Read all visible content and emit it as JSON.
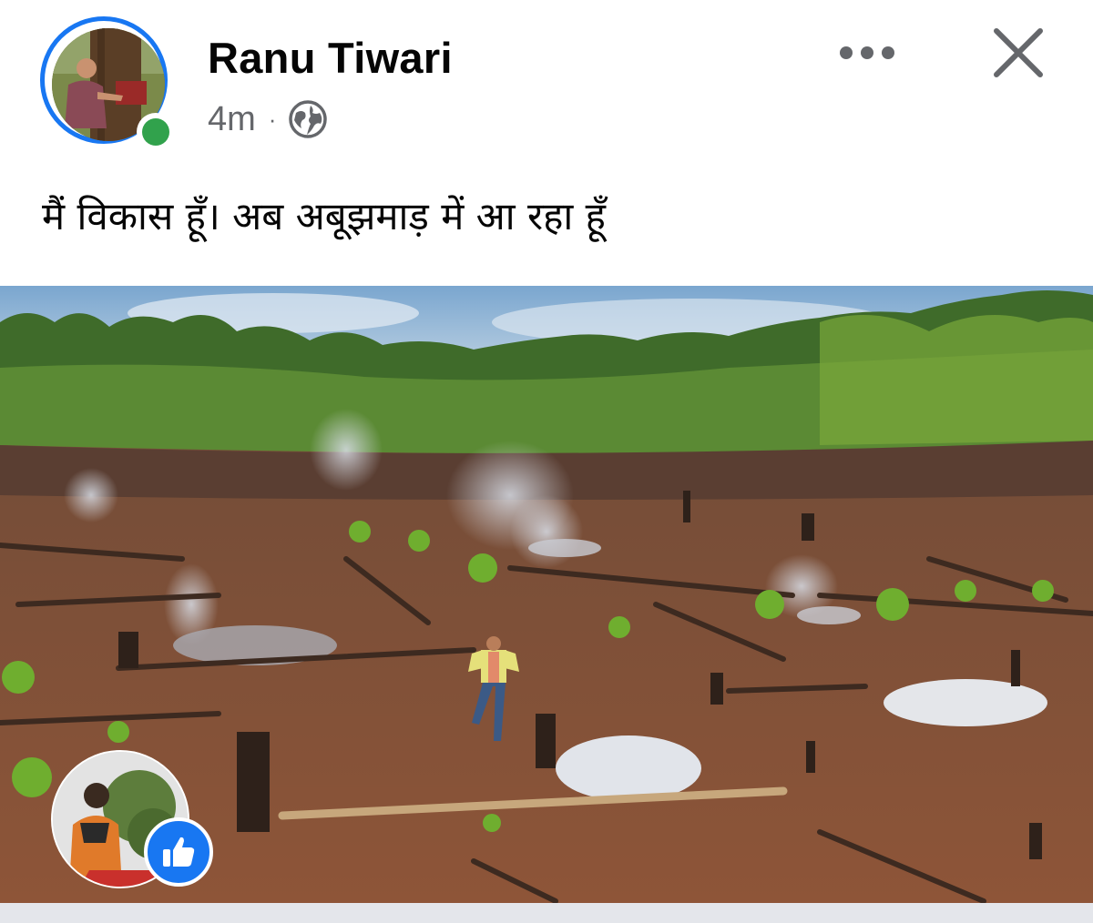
{
  "post": {
    "author": "Ranu Tiwari",
    "time": "4m",
    "separator": "·",
    "audience_icon": "globe-icon",
    "caption": "मैं विकास हूँ। अब अबूझमाड़ में आ रहा हूँ",
    "image_description": "deforested-burning-land-photo"
  },
  "actions": {
    "more_icon": "more-horizontal-icon",
    "close_icon": "close-icon"
  },
  "reaction": {
    "type": "like",
    "icon": "thumbs-up-icon"
  },
  "colors": {
    "accent": "#1877f2",
    "online": "#31a24c",
    "secondary_text": "#65676b",
    "primary_text": "#050505"
  }
}
